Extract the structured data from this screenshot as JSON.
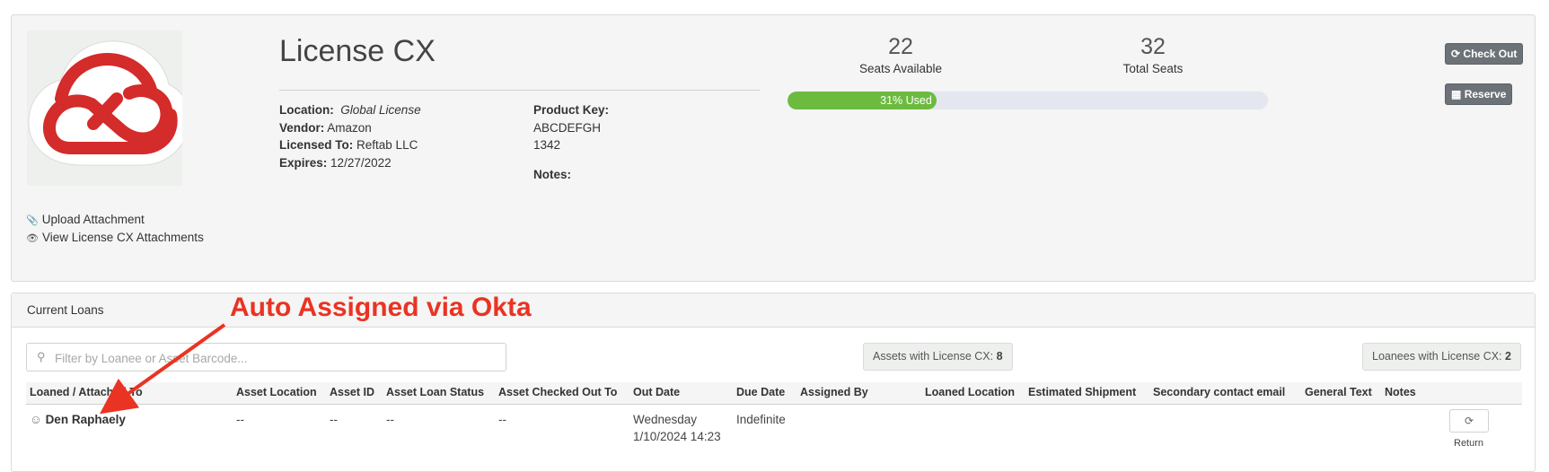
{
  "license": {
    "title": "License CX",
    "location_label": "Location:",
    "location_value": "Global License",
    "vendor_label": "Vendor:",
    "vendor_value": "Amazon",
    "licensed_to_label": "Licensed To:",
    "licensed_to_value": "Reftab LLC",
    "expires_label": "Expires:",
    "expires_value": "12/27/2022",
    "product_key_label": "Product Key:",
    "product_key_line1": "ABCDEFGH",
    "product_key_line2": "1342",
    "notes_label": "Notes:"
  },
  "attachments": {
    "upload_label": "Upload Attachment",
    "view_label": "View License CX Attachments"
  },
  "stats": {
    "seats_available": "22",
    "seats_available_label": "Seats Available",
    "total_seats": "32",
    "total_seats_label": "Total Seats",
    "used_fraction": 0.31,
    "used_label": "31% Used"
  },
  "actions": {
    "check_out_label": "Check Out",
    "reserve_label": "Reserve"
  },
  "loans": {
    "section_title": "Current Loans",
    "filter_placeholder": "Filter by Loanee or Asset Barcode...",
    "assets_count_label": "Assets with License CX:",
    "assets_count": "8",
    "loanees_count_label": "Loanees with License CX:",
    "loanees_count": "2",
    "columns": [
      "Loaned / Attached To",
      "Asset Location",
      "Asset ID",
      "Asset Loan Status",
      "Asset Checked Out To",
      "Out Date",
      "Due Date",
      "Assigned By",
      "Loaned Location",
      "Estimated Shipment",
      "Secondary contact email",
      "General Text",
      "Notes"
    ],
    "rows": [
      {
        "loanee": "Den Raphaely",
        "asset_location": "--",
        "asset_id": "--",
        "asset_loan_status": "--",
        "asset_checked_out_to": "--",
        "out_date_line1": "Wednesday",
        "out_date_line2": "1/10/2024 14:23",
        "due_date": "Indefinite",
        "return_label": "Return"
      }
    ]
  },
  "annotation": {
    "text": "Auto Assigned via Okta",
    "color": "#ea3323"
  },
  "colors": {
    "progress_fill": "#6cbb3f",
    "progress_track": "#e4e7ef",
    "button_dark": "#6c7278",
    "logo_red": "#d42b2b"
  }
}
